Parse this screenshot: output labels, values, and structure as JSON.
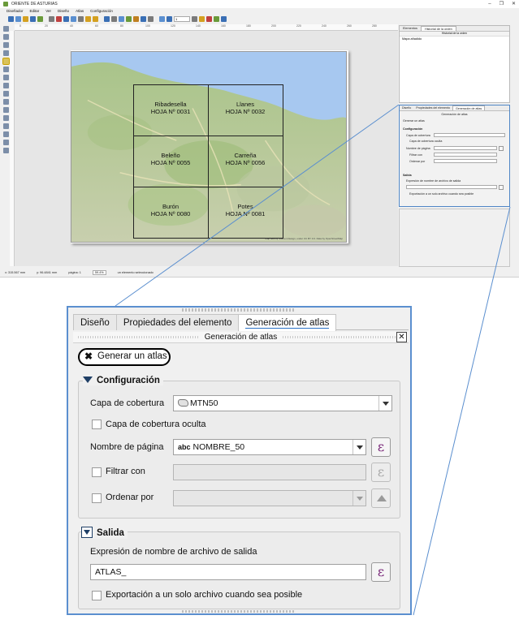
{
  "app": {
    "title": "ORIENTE DE ASTURIAS",
    "window_buttons": [
      "–",
      "❐",
      "✕"
    ],
    "menu": [
      "Diseñador",
      "Editar",
      "Ver",
      "Diseño",
      "Atlas",
      "Configuración"
    ],
    "page_field": "1"
  },
  "ruler_ticks": [
    "0",
    "20",
    "40",
    "60",
    "80",
    "100",
    "120",
    "140",
    "160",
    "180",
    "200",
    "220",
    "240",
    "260",
    "280"
  ],
  "map": {
    "sheets": [
      {
        "name": "Ribadesella",
        "code": "HOJA Nº  0031"
      },
      {
        "name": "Llanes",
        "code": "HOJA Nº  0032"
      },
      {
        "name": "Beleño",
        "code": "HOJA Nº  0055"
      },
      {
        "name": "Carreña",
        "code": "HOJA Nº  0056"
      },
      {
        "name": "Burón",
        "code": "HOJA Nº  0080"
      },
      {
        "name": "Potes",
        "code": "HOJA Nº  0081"
      }
    ],
    "attribution": "Map tiles by Stamen Design, under CC BY 3.0. Data by OpenStreetMap"
  },
  "status": {
    "x": "x: 315.567 mm",
    "y": "y: 96.4841 mm",
    "page": "página: 1",
    "zoom": "59.4%",
    "selection": "un elemento seleccionado"
  },
  "dock_top": {
    "tabs": [
      "Elementos",
      "Historial de la orden"
    ],
    "header": "Historial de la orden",
    "items": [
      "Mapa añadido"
    ]
  },
  "atlas": {
    "tabs": [
      "Diseño",
      "Propiedades del elemento",
      "Generación de atlas"
    ],
    "header": "Generación de atlas",
    "close": "✕",
    "generate_label": "Generar un atlas",
    "generate_mark": "✖",
    "config": {
      "title": "Configuración",
      "coverage_label": "Capa de cobertura",
      "coverage_value": "MTN50",
      "hidden_label": "Capa de cobertura oculta",
      "pagename_label": "Nombre de página",
      "pagename_prefix": "abc",
      "pagename_value": "NOMBRE_50",
      "filter_label": "Filtrar con",
      "sort_label": "Ordenar por",
      "expr_glyph": "ε"
    },
    "output": {
      "title": "Salida",
      "expr_label": "Expresión de nombre de archivo de salida",
      "expr_value": "ATLAS_",
      "single_file_label": "Exportación a un solo archivo cuando sea posible"
    }
  },
  "colors": {
    "accent": "#2c72c7",
    "callout": "#5b8fcf",
    "expr_icon": "#7a2a7a",
    "group_arrow": "#1f3f66"
  }
}
